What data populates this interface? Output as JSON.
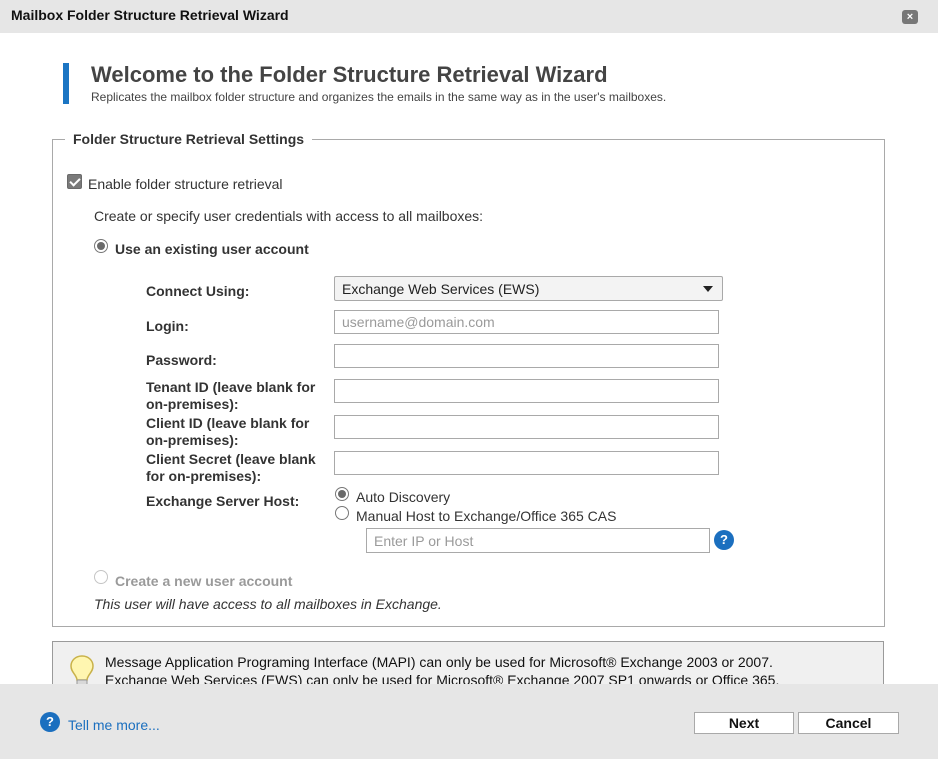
{
  "window": {
    "title": "Mailbox Folder Structure Retrieval Wizard",
    "close_label": "×"
  },
  "header": {
    "title": "Welcome to the Folder Structure Retrieval Wizard",
    "subtitle": "Replicates the mailbox folder structure and organizes the emails in the same way as in the user's mailboxes."
  },
  "settings": {
    "legend": "Folder Structure Retrieval Settings",
    "enable_label": "Enable folder structure retrieval",
    "enable_checked": true,
    "credentials_prompt": "Create or specify user credentials with access to all mailboxes:",
    "existing_account_label": "Use an existing user account",
    "new_account_label": "Create a new user account",
    "access_note": "This user will have access to all mailboxes in Exchange."
  },
  "form": {
    "connect_using_label": "Connect Using:",
    "connect_using_value": "Exchange Web Services (EWS)",
    "login_label": "Login:",
    "login_placeholder": "username@domain.com",
    "password_label": "Password:",
    "tenant_id_label": "Tenant ID (leave blank for on-premises):",
    "client_id_label": "Client ID (leave blank for on-premises):",
    "client_secret_label": "Client Secret (leave blank for on-premises):",
    "exchange_host_label": "Exchange Server Host:",
    "auto_discovery_label": "Auto Discovery",
    "manual_host_label": "Manual Host to Exchange/Office 365 CAS",
    "host_placeholder": "Enter IP or Host",
    "help_icon_glyph": "?"
  },
  "note": {
    "line1": "Message Application Programing Interface (MAPI) can only be used for Microsoft® Exchange 2003 or 2007.",
    "line2": "Exchange Web Services (EWS) can only be used for Microsoft® Exchange 2007 SP1 onwards or Office 365."
  },
  "footer": {
    "help_icon_glyph": "?",
    "tell_me_more": "Tell me more...",
    "next_label": "Next",
    "cancel_label": "Cancel"
  },
  "colors": {
    "accent": "#1b75c3",
    "link": "#1b6fbf",
    "chrome": "#e6e6e6"
  }
}
